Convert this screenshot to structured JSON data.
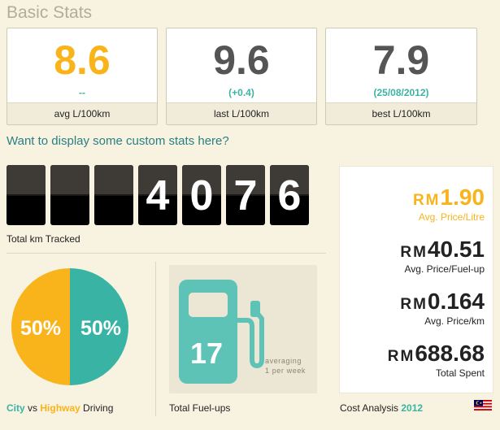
{
  "page": {
    "title": "Basic Stats"
  },
  "cards": [
    {
      "value": "8.6",
      "sub": "--",
      "label": "avg L/100km",
      "color": "#f9b31b"
    },
    {
      "value": "9.6",
      "sub": "(+0.4)",
      "label": "last L/100km",
      "color": "#555555"
    },
    {
      "value": "7.9",
      "sub": "(25/08/2012)",
      "label": "best L/100km",
      "color": "#555555"
    }
  ],
  "custom_stats_link": "Want to display some custom stats here?",
  "odometer": {
    "digits": [
      "",
      "",
      "",
      "4",
      "0",
      "7",
      "6"
    ],
    "label": "Total km Tracked"
  },
  "driving": {
    "city_percent": "50%",
    "highway_percent": "50%",
    "city_label": "City",
    "vs_label": "vs",
    "highway_label": "Highway",
    "driving_label": "Driving",
    "city_color": "#39b3a4",
    "highway_color": "#f9b31b"
  },
  "fuelups": {
    "count": "17",
    "note_line1": "averaging",
    "note_line2": "1 per week",
    "label": "Total Fuel-ups",
    "icon": "fuel-pump-icon"
  },
  "cost": {
    "currency": "RM",
    "items": [
      {
        "value": "1.90",
        "label": "Avg. Price/Litre",
        "color": "#f9b31b"
      },
      {
        "value": "40.51",
        "label": "Avg. Price/Fuel-up",
        "color": "#111111"
      },
      {
        "value": "0.164",
        "label": "Avg. Price/km",
        "color": "#111111"
      },
      {
        "value": "688.68",
        "label": "Total Spent",
        "color": "#111111"
      }
    ],
    "caption": "Cost Analysis",
    "year": "2012",
    "flag_icon": "malaysia-flag-icon"
  }
}
